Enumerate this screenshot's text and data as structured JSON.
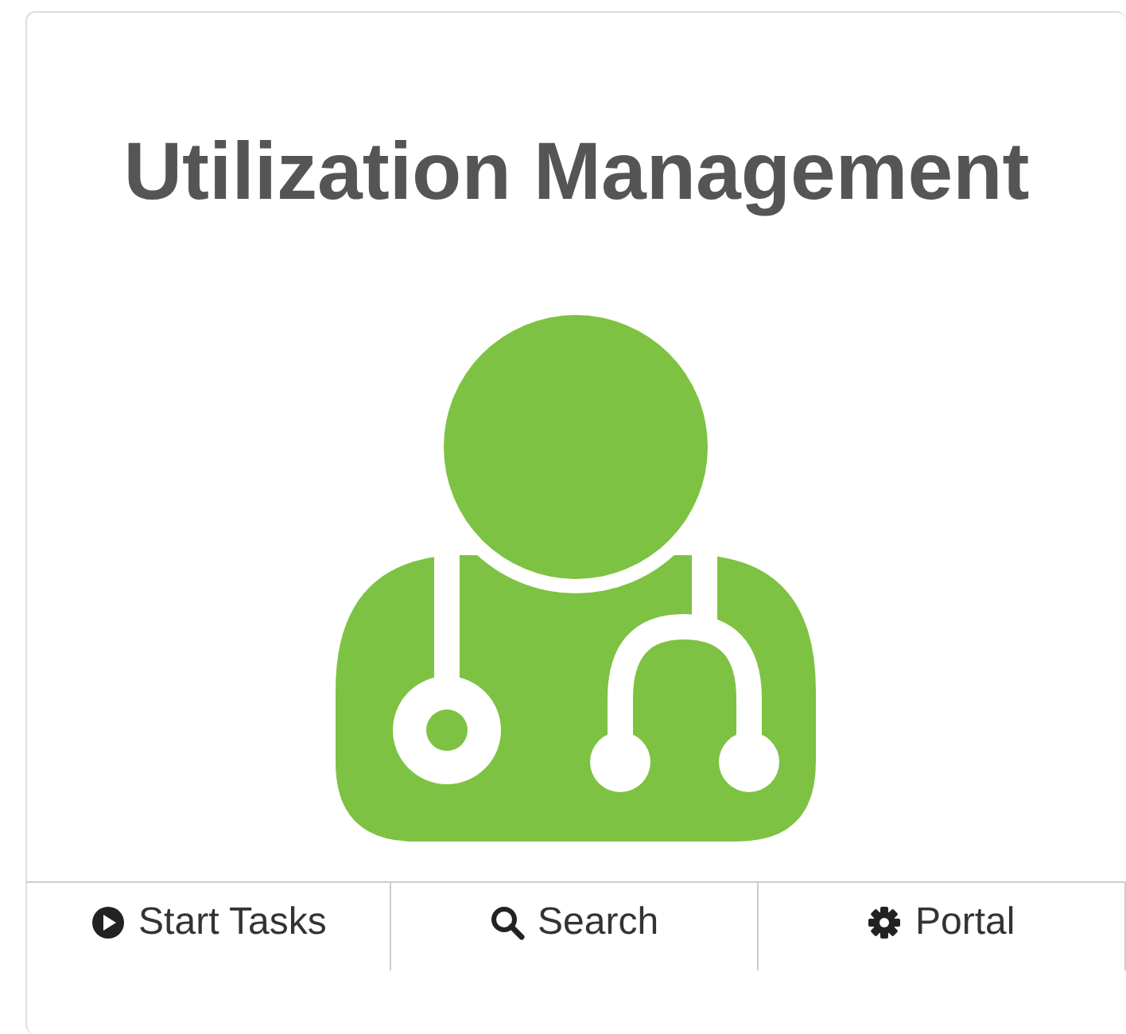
{
  "card": {
    "title": "Utilization Management",
    "buttons": [
      {
        "label": "Start Tasks"
      },
      {
        "label": "Search"
      },
      {
        "label": "Portal"
      }
    ]
  }
}
